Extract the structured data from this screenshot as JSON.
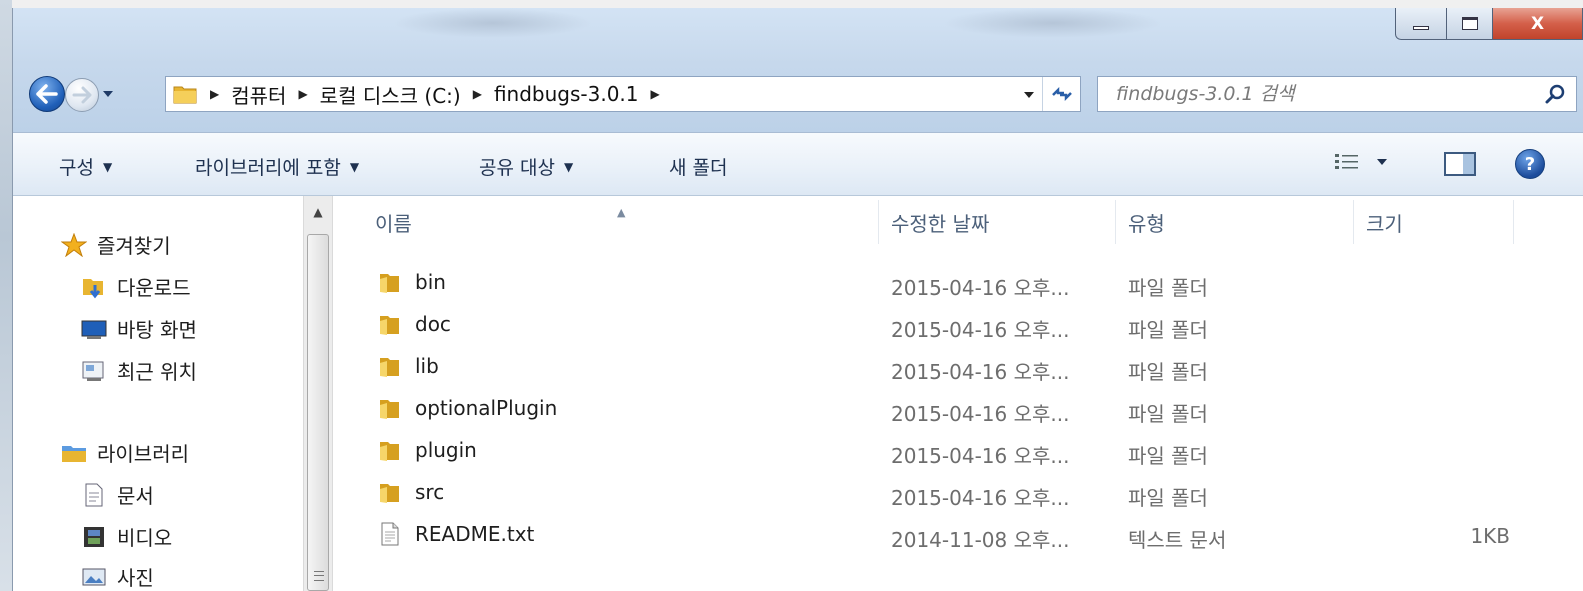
{
  "window": {
    "close_label": "X"
  },
  "nav": {
    "breadcrumbs": [
      "컴퓨터",
      "로컬 디스크 (C:)",
      "findbugs-3.0.1"
    ]
  },
  "search": {
    "placeholder": "findbugs-3.0.1 검색"
  },
  "toolbar": {
    "organize": "구성",
    "include_library": "라이브러리에 포함",
    "share_with": "공유 대상",
    "new_folder": "새 폴더",
    "help": "?"
  },
  "sidebar": {
    "favorites": {
      "label": "즐겨찾기",
      "icon": "star-icon",
      "items": [
        {
          "label": "다운로드",
          "icon": "downloads-folder-icon"
        },
        {
          "label": "바탕 화면",
          "icon": "desktop-icon"
        },
        {
          "label": "최근 위치",
          "icon": "recent-places-icon"
        }
      ]
    },
    "libraries": {
      "label": "라이브러리",
      "icon": "library-icon",
      "items": [
        {
          "label": "문서",
          "icon": "document-icon"
        },
        {
          "label": "비디오",
          "icon": "video-icon"
        },
        {
          "label": "사진",
          "icon": "picture-icon"
        }
      ]
    }
  },
  "table": {
    "columns": [
      "이름",
      "수정한 날짜",
      "유형",
      "크기"
    ],
    "rows": [
      {
        "name": "bin",
        "date": "2015-04-16 오후...",
        "type": "파일 폴더",
        "size": "",
        "icon": "folder-icon"
      },
      {
        "name": "doc",
        "date": "2015-04-16 오후...",
        "type": "파일 폴더",
        "size": "",
        "icon": "folder-icon"
      },
      {
        "name": "lib",
        "date": "2015-04-16 오후...",
        "type": "파일 폴더",
        "size": "",
        "icon": "folder-icon"
      },
      {
        "name": "optionalPlugin",
        "date": "2015-04-16 오후...",
        "type": "파일 폴더",
        "size": "",
        "icon": "folder-icon"
      },
      {
        "name": "plugin",
        "date": "2015-04-16 오후...",
        "type": "파일 폴더",
        "size": "",
        "icon": "folder-icon"
      },
      {
        "name": "src",
        "date": "2015-04-16 오후...",
        "type": "파일 폴더",
        "size": "",
        "icon": "folder-icon"
      },
      {
        "name": "README.txt",
        "date": "2014-11-08 오후...",
        "type": "텍스트 문서",
        "size": "1KB",
        "icon": "text-file-icon"
      }
    ]
  },
  "colors": {
    "accent": "#1f5fb8",
    "folder": "#e8b531",
    "header_text": "#4c607a"
  }
}
